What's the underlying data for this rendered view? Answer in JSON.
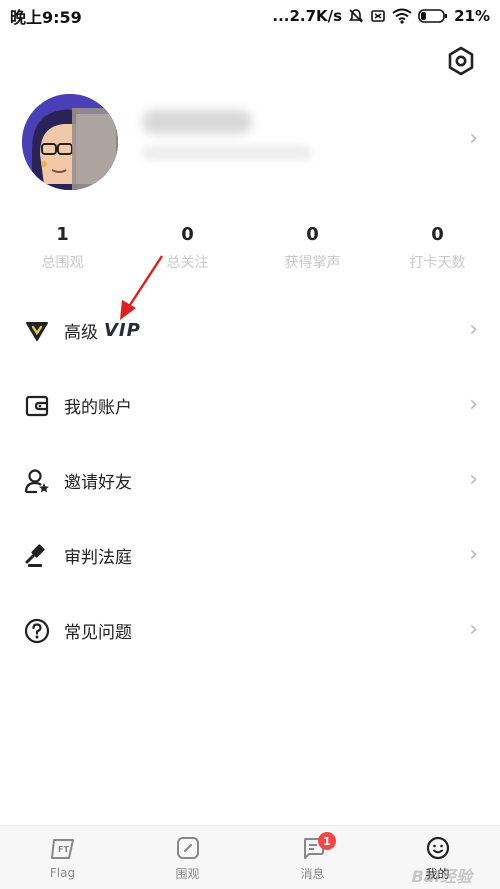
{
  "status_bar": {
    "time": "晚上9:59",
    "network_speed": "...2.7K/s",
    "battery": "21%"
  },
  "profile": {
    "avatar_icon": "avatar-character"
  },
  "stats": [
    {
      "value": "1",
      "label": "总围观"
    },
    {
      "value": "0",
      "label": "总关注"
    },
    {
      "value": "0",
      "label": "获得掌声"
    },
    {
      "value": "0",
      "label": "打卡天数"
    }
  ],
  "menu": {
    "vip": {
      "label": "高级",
      "badge": "VIP",
      "icon": "vip-diamond-icon"
    },
    "account": {
      "label": "我的账户",
      "icon": "wallet-icon"
    },
    "invite": {
      "label": "邀请好友",
      "icon": "user-star-icon"
    },
    "court": {
      "label": "审判法庭",
      "icon": "gavel-icon"
    },
    "faq": {
      "label": "常见问题",
      "icon": "question-icon"
    }
  },
  "tabs": [
    {
      "label": "Flag",
      "icon": "flag-icon"
    },
    {
      "label": "围观",
      "icon": "compass-icon"
    },
    {
      "label": "消息",
      "icon": "message-icon",
      "badge": "1"
    },
    {
      "label": "我的",
      "icon": "smile-icon"
    }
  ],
  "watermark": "Bai经验",
  "colors": {
    "badge": "#f04848",
    "annotation_arrow": "#e02020",
    "avatar_bg": "#4b3fb7"
  }
}
